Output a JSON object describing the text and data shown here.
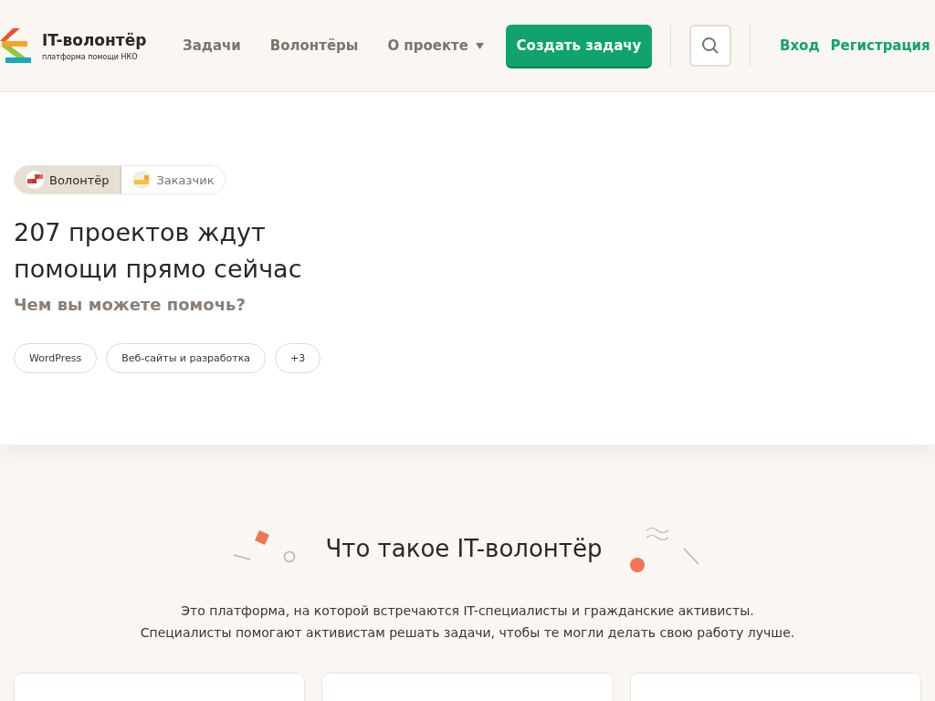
{
  "header": {
    "logo_title": "IT-волонтёр",
    "logo_subtitle": "платформа помощи НКО",
    "nav": [
      {
        "label": "Задачи",
        "dropdown": false
      },
      {
        "label": "Волонтёры",
        "dropdown": false
      },
      {
        "label": "О проекте",
        "dropdown": true
      }
    ],
    "create_button": "Создать задачу",
    "login": "Вход",
    "register": "Регистрация"
  },
  "hero": {
    "roles": [
      {
        "label": "Волонтёр",
        "selected": true
      },
      {
        "label": "Заказчик",
        "selected": false
      }
    ],
    "title": "207 проектов ждут помощи прямо сейчас",
    "subtitle": "Чем вы можете помочь?",
    "tags": [
      "WordPress",
      "Веб-сайты и разработка",
      "+3"
    ]
  },
  "about": {
    "title": "Что такое IT-волонтёр",
    "text_lines": [
      "Это платформа, на которой встречаются IT-специалисты и гражданские активисты.",
      "Специалисты помогают активистам решать задачи, чтобы те могли делать свою работу лучше."
    ]
  }
}
